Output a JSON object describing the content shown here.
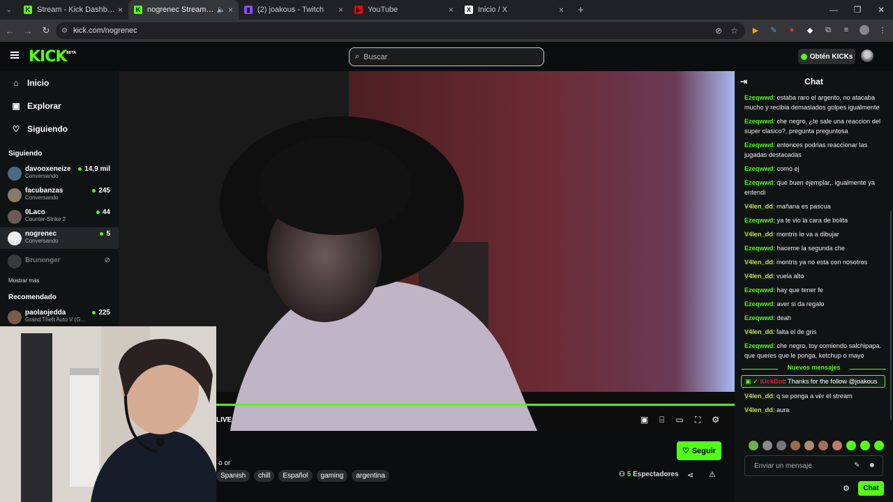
{
  "browser": {
    "tabs": [
      {
        "title": "Stream - Kick Dashboard",
        "fav_color": "#53fc18",
        "fav": "K"
      },
      {
        "title": "nogrenec Stream - Watch Live",
        "fav_color": "#53fc18",
        "fav": "K",
        "active": true
      },
      {
        "title": "(2) joakous - Twitch",
        "fav_color": "#9146ff",
        "fav": "▮"
      },
      {
        "title": "YouTube",
        "fav_color": "#ff0000",
        "fav": "▶"
      },
      {
        "title": "Inicio / X",
        "fav_color": "#ffffff",
        "fav": "X"
      }
    ],
    "url": "kick.com/nogrenec"
  },
  "header": {
    "logo": "KICK",
    "logo_badge": "BETA",
    "search_placeholder": "Buscar",
    "kicks_label": "Obtén KICKs"
  },
  "sidebar": {
    "nav": [
      {
        "icon": "home-icon",
        "label": "Inicio"
      },
      {
        "icon": "compass-icon",
        "label": "Explorar"
      },
      {
        "icon": "heart-icon",
        "label": "Siguiendo"
      }
    ],
    "following_title": "Siguiendo",
    "following": [
      {
        "name": "davooxeneize",
        "sub": "Conversando",
        "viewers": "14,9 mil",
        "color": "#4a6a8a"
      },
      {
        "name": "facubanzas",
        "sub": "Conversando",
        "viewers": "245",
        "color": "#8a7a6a"
      },
      {
        "name": "0Laco",
        "sub": "Counter-Strike 2",
        "viewers": "44",
        "color": "#6a5a5a"
      },
      {
        "name": "nogrenec",
        "sub": "Conversando",
        "viewers": "5",
        "color": "#eeeeee"
      }
    ],
    "offline": "Brunenger",
    "show_more": "Mostrar más",
    "recommended_title": "Recomendado",
    "recommended": [
      {
        "name": "paolaojedda",
        "sub": "Grand Theft Auto V (G...",
        "viewers": "225",
        "color": "#7a5a4a"
      }
    ]
  },
  "stream": {
    "live": "LIVE",
    "title_fragment": "o or",
    "follow": "Seguir",
    "tags": [
      "Spanish",
      "chill",
      "Español",
      "gaming",
      "argentina"
    ],
    "viewers_count": "5",
    "viewers_label": "Espectadores",
    "progress": 1.0
  },
  "chat": {
    "title": "Chat",
    "messages": [
      {
        "user": "Ezeqwwd",
        "text": "estaba raro el argento, no atacaba mucho y recibia demasiados golpes igualmente",
        "color": "#53fc18"
      },
      {
        "user": "Ezeqwwd",
        "text": "che negro, ¿te sale una reaccion del super clasico?, pregunta preguntosa",
        "color": "#53fc18"
      },
      {
        "user": "Ezeqwwd",
        "text": "entonces podrias reaccionar las jugadas destacadas",
        "color": "#53fc18"
      },
      {
        "user": "Ezeqwwd",
        "text": "como ej",
        "color": "#53fc18"
      },
      {
        "user": "Ezeqwwd",
        "text": "que buen ejemplar,. igualmente ya entendi",
        "color": "#53fc18"
      },
      {
        "user": "V4len_dd",
        "text": "mañana es pascua",
        "color": "#c4e536"
      },
      {
        "user": "Ezeqwwd",
        "text": "ya te vio la cara de bolita",
        "color": "#53fc18"
      },
      {
        "user": "V4len_dd",
        "text": "montris lo va a dibujar",
        "color": "#c4e536"
      },
      {
        "user": "Ezeqwwd",
        "text": "haceme la segunda che",
        "color": "#53fc18"
      },
      {
        "user": "V4len_dd",
        "text": "montris ya no esta con nosotros",
        "color": "#c4e536"
      },
      {
        "user": "V4len_dd",
        "text": "vuela alto",
        "color": "#c4e536"
      },
      {
        "user": "Ezeqwwd",
        "text": "hay que tener fe",
        "color": "#53fc18"
      },
      {
        "user": "Ezeqwwd",
        "text": "aver si da regalo",
        "color": "#53fc18"
      },
      {
        "user": "Ezeqwwd",
        "text": "deah",
        "color": "#53fc18"
      },
      {
        "user": "V4len_dd",
        "text": "falta el de gris",
        "color": "#c4e536"
      },
      {
        "user": "Ezeqwwd",
        "text": "che negro, toy comiendo salchipapa. que queres que le ponga, ketchup o mayo",
        "color": "#53fc18"
      }
    ],
    "new_messages_label": "Nuevos mensajes",
    "bot_message": {
      "user": "KickBot",
      "text": "Thanks for the follow @joakous",
      "color": "#e9113c"
    },
    "after_messages": [
      {
        "user": "V4len_dd",
        "text": "q se ponga a ver el stream",
        "color": "#c4e536"
      },
      {
        "user": "V4len_dd",
        "text": "aura",
        "color": "#c4e536"
      }
    ],
    "input_placeholder": "Enviar un mensaje",
    "send_label": "Chat"
  }
}
